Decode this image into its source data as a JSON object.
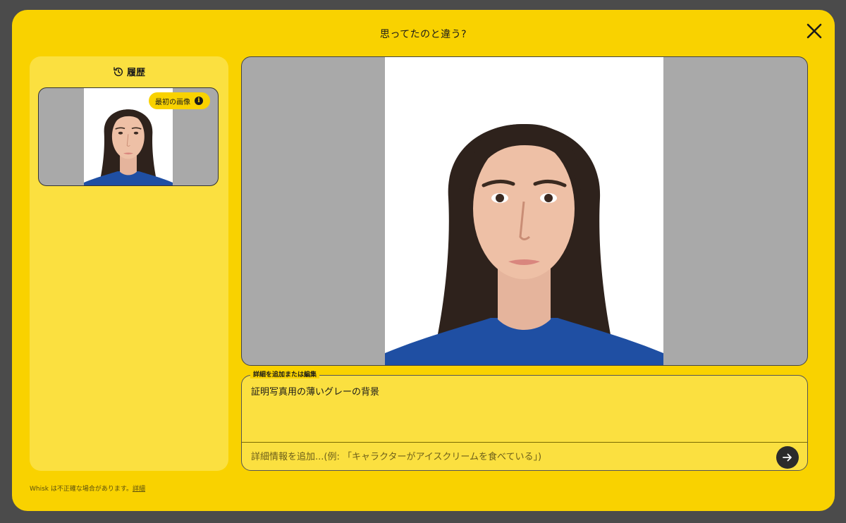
{
  "modal": {
    "title": "思ってたのと違う?"
  },
  "history": {
    "title": "履歴",
    "items": [
      {
        "badge": "最初の画像"
      }
    ]
  },
  "editor": {
    "legend": "詳細を追加または編集",
    "current_text": "証明写真用の薄いグレーの背景",
    "placeholder": "詳細情報を追加...(例: 「キャラクターがアイスクリームを食べている」)"
  },
  "footer": {
    "disclaimer": "Whisk は不正確な場合があります。",
    "link": "詳細"
  },
  "colors": {
    "modal_bg": "#f9d200",
    "panel_bg": "#fbe040",
    "preview_bg": "#a9a9a9",
    "submit_bg": "#2b2b2b"
  },
  "icons": {
    "close": "close-icon",
    "history": "history-icon",
    "info": "info-icon",
    "submit": "arrow-right-icon"
  }
}
